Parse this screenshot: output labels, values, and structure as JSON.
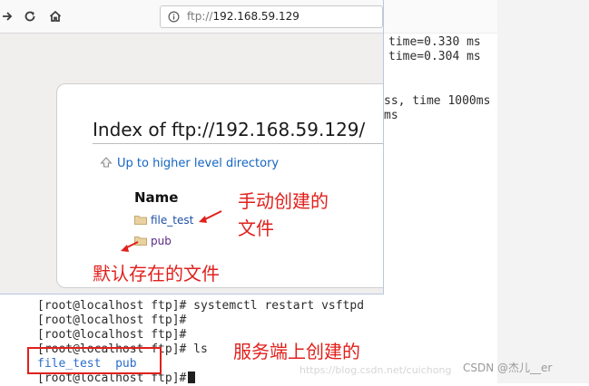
{
  "terminal": {
    "ping_lines": [
      "time=0.330 ms",
      "time=0.304 ms",
      "ss, time 1000ms",
      "ms"
    ],
    "prompt_lines": [
      "[root@localhost ftp]# systemctl restart vsftpd",
      "[root@localhost ftp]#",
      "[root@localhost ftp]#",
      "[root@localhost ftp]# ls"
    ],
    "ls_output": "file_test  pub",
    "last_prompt": "[root@localhost ftp]#"
  },
  "browser": {
    "url_prefix": "ftp://",
    "url_host": "192.168.59.129",
    "index_title": "Index of ftp://192.168.59.129/",
    "up_link": "Up to higher level directory",
    "column_name": "Name",
    "entries": [
      {
        "name": "file_test",
        "icon": "folder-icon"
      },
      {
        "name": "pub",
        "icon": "folder-icon"
      }
    ]
  },
  "annotations": {
    "manual_created_line1": "手动创建的",
    "manual_created_line2": "文件",
    "default_files": "默认存在的文件",
    "server_created": "服务端上创建的",
    "color": "#e0201c"
  },
  "watermark": {
    "text": "CSDN @杰儿__er",
    "url": "https://blog.csdn.net/cuichong"
  }
}
